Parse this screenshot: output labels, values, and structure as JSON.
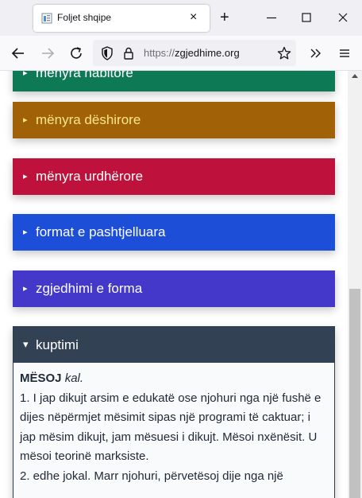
{
  "browser": {
    "tab_title": "Foljet shqipe",
    "tab_close": "×",
    "new_tab": "+",
    "url_protocol": "https://",
    "url_domain": "zgjedhime.org"
  },
  "sections": [
    {
      "caret": "▸",
      "label": "mënyra habitore",
      "color": "#0e7a55"
    },
    {
      "caret": "▸",
      "label": "mënyra dëshirore",
      "color": "#a16207"
    },
    {
      "caret": "▸",
      "label": "mënyra urdhërore",
      "color": "#be123c"
    },
    {
      "caret": "▸",
      "label": "format e pashtjelluara",
      "color": "#1d4ed8"
    },
    {
      "caret": "▸",
      "label": "zgjedhimi e forma",
      "color": "#4338ca"
    }
  ],
  "meaning": {
    "caret": "▾",
    "label": "kuptimi",
    "headword": "MËSOJ",
    "pos": "kal.",
    "definitions": [
      "1. I jap dikujt arsim e edukatë ose njohuri nga një fushë e dijes nëpërmjet mësimit sipas një programi të caktuar; i jap mësim dikujt, jam mësuesi i dikujt. Mësoi nxënësit. U mësoi teorinë marksiste.",
      "2. edhe jokal. Marr njohuri, përvetësoj dije nga një"
    ]
  }
}
